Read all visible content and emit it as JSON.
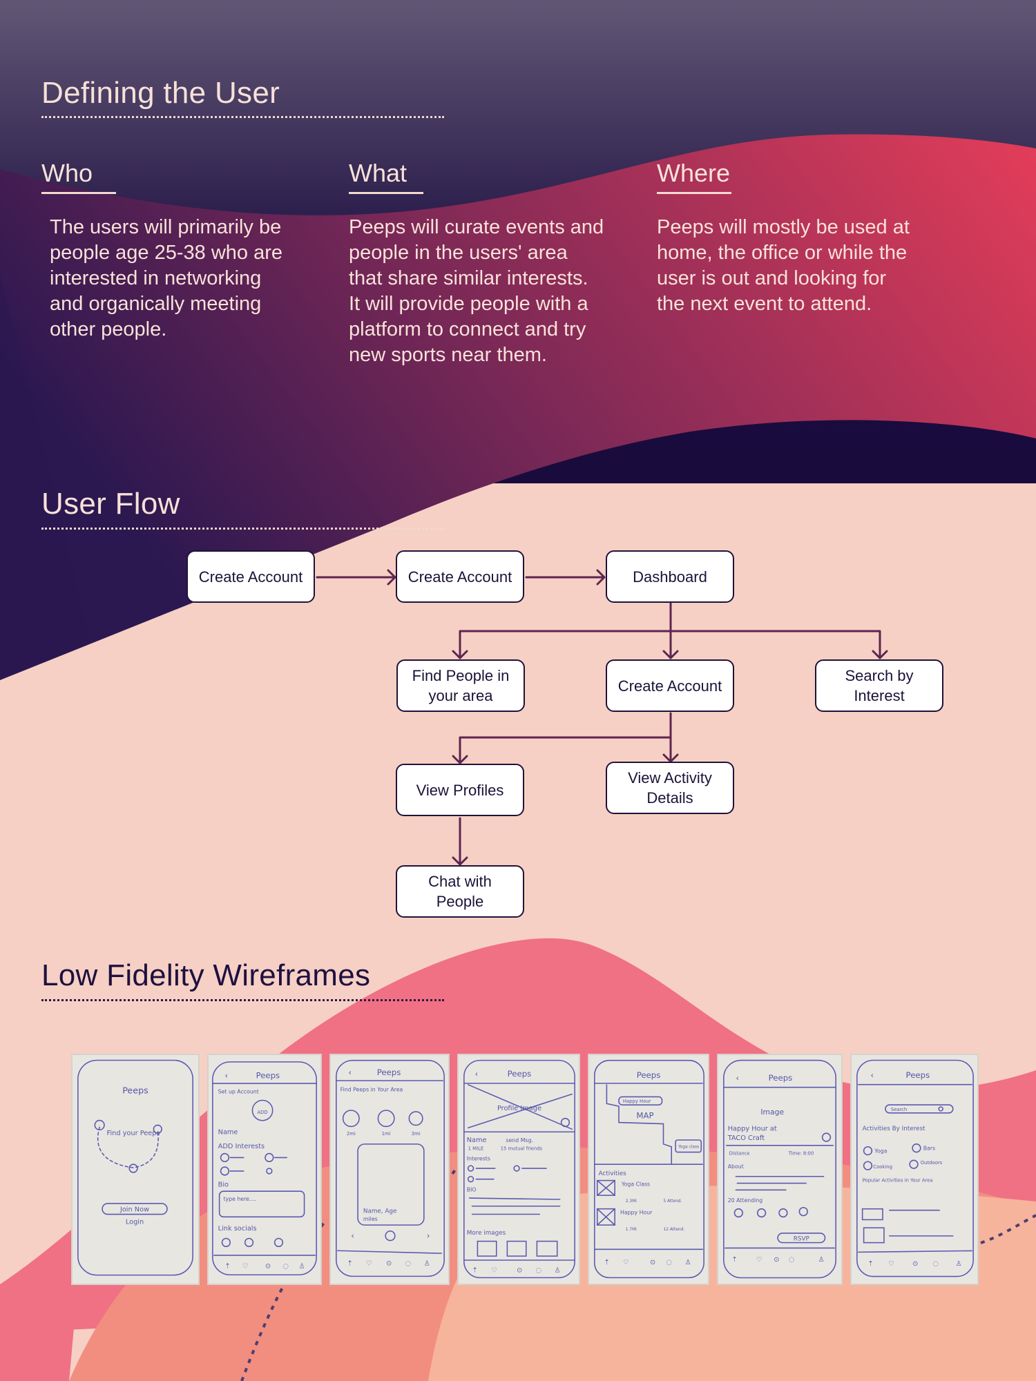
{
  "colors": {
    "deep_navy": "#1a0c3e",
    "plum": "#7a2a55",
    "crimson": "#e13f5a",
    "peach_bg": "#f6d0c4",
    "pink": "#f07084",
    "salmon": "#f28e80",
    "light_salmon": "#f7b49c",
    "flow_line": "#5e2450",
    "node_border": "#1f1238"
  },
  "defining": {
    "title": "Defining the User",
    "columns": [
      {
        "heading": "Who",
        "body": "The users will primarily be people age 25-38 who are interested in networking and organically meeting other people."
      },
      {
        "heading": "What",
        "body": "Peeps will curate events and people in the users' area that share similar interests. It will provide people with a platform to connect and try new sports near them."
      },
      {
        "heading": "Where",
        "body": "Peeps will mostly be used at home, the office or while the user is out and looking for the next event to attend."
      }
    ]
  },
  "user_flow": {
    "title": "User Flow",
    "nodes": [
      {
        "id": "n1",
        "label": "Create Account"
      },
      {
        "id": "n2",
        "label": "Create Account"
      },
      {
        "id": "n3",
        "label": "Dashboard"
      },
      {
        "id": "n4",
        "label": "Find People in your area"
      },
      {
        "id": "n5",
        "label": "Create Account"
      },
      {
        "id": "n6",
        "label": "Search by Interest"
      },
      {
        "id": "n7",
        "label": "View Profiles"
      },
      {
        "id": "n8",
        "label": "View Activity Details"
      },
      {
        "id": "n9",
        "label": "Chat with People"
      }
    ],
    "edges": [
      {
        "from": "n1",
        "to": "n2"
      },
      {
        "from": "n2",
        "to": "n3"
      },
      {
        "from": "n3",
        "to": "n4"
      },
      {
        "from": "n3",
        "to": "n5"
      },
      {
        "from": "n3",
        "to": "n6"
      },
      {
        "from": "n5",
        "to": "n7"
      },
      {
        "from": "n5",
        "to": "n8"
      },
      {
        "from": "n7",
        "to": "n9"
      }
    ]
  },
  "wireframes": {
    "title": "Low Fidelity Wireframes",
    "screens": [
      {
        "name": "splash",
        "app": "Peeps",
        "tagline": "Find your Peeps",
        "primary": "Join Now",
        "secondary": "Login"
      },
      {
        "name": "setup-account",
        "app": "Peeps",
        "heading": "Set up Account",
        "avatar": "ADD",
        "name_label": "Name",
        "interests_label": "ADD Interests",
        "bio_label": "Bio",
        "bio_placeholder": "type here....",
        "socials_label": "Link socials"
      },
      {
        "name": "find-peeps",
        "app": "Peeps",
        "heading": "Find Peeps in Your Area",
        "distances": [
          "2mi",
          "1mi",
          "3mi"
        ],
        "card_name": "Name, Age",
        "card_dist": "miles"
      },
      {
        "name": "profile",
        "app": "Peeps",
        "image_label": "Profile Image",
        "name_label": "Name",
        "send_msg": "send Msg.",
        "distance": "1 MILE",
        "mutual": "15 mutual friends",
        "interests_label": "Interests",
        "bio_label": "BIO",
        "more_images": "More images"
      },
      {
        "name": "map",
        "app": "Peeps",
        "map_label": "MAP",
        "pin1": "Happy Hour",
        "pin2": "Yoga class",
        "activities_label": "Activities",
        "items": [
          {
            "title": "Yoga Class",
            "dist": "2.3Mi",
            "attend": "5 Attend."
          },
          {
            "title": "Happy Hour",
            "dist": "1.7Mi",
            "attend": "12 Attend."
          }
        ]
      },
      {
        "name": "event-detail",
        "app": "Peeps",
        "image_label": "Image",
        "event_title_1": "Happy Hour at",
        "event_title_2": "TACO Craft",
        "distance_label": "Distance",
        "time_label": "Time: 8:00",
        "about_label": "About",
        "attending": "20 Attending",
        "rsvp": "RSVP"
      },
      {
        "name": "search",
        "app": "Peeps",
        "search_placeholder": "Search",
        "by_interest": "Activities By Interest",
        "options": [
          "Yoga",
          "Bars",
          "Cooking",
          "Outdoors"
        ],
        "popular": "Popular Activities in Your Area"
      }
    ]
  }
}
